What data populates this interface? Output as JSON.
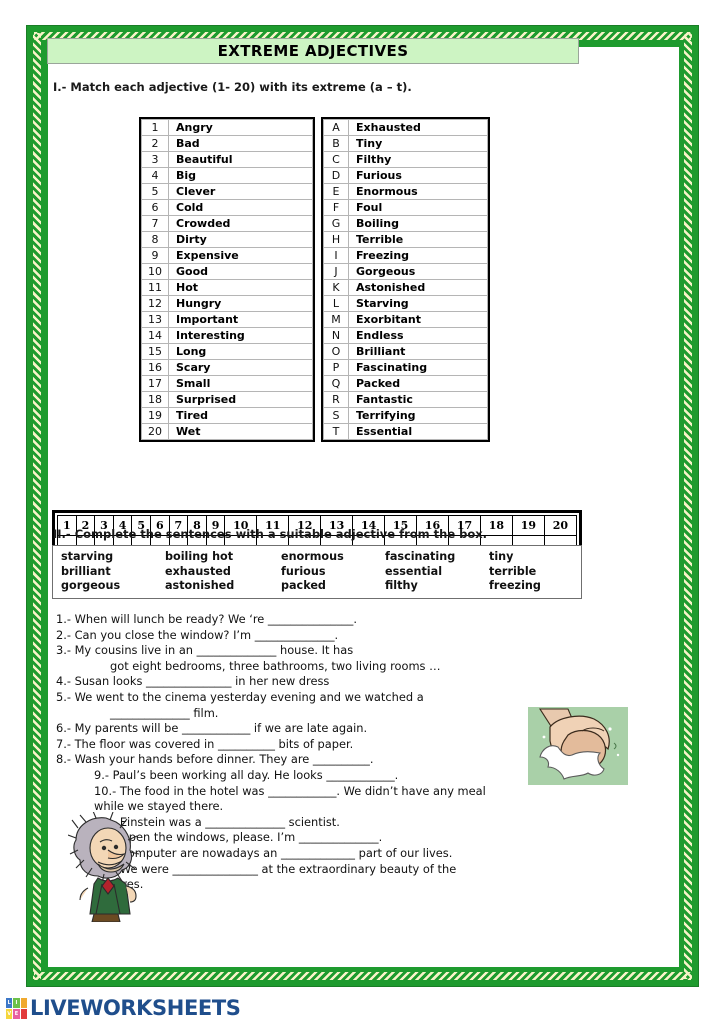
{
  "document": {
    "title": "EXTREME ADJECTIVES"
  },
  "sections": {
    "one": {
      "instruction": "I.- Match each adjective (1- 20) with its extreme (a – t).",
      "left_column": [
        {
          "key": "1",
          "word": "Angry"
        },
        {
          "key": "2",
          "word": "Bad"
        },
        {
          "key": "3",
          "word": "Beautiful"
        },
        {
          "key": "4",
          "word": "Big"
        },
        {
          "key": "5",
          "word": "Clever"
        },
        {
          "key": "6",
          "word": "Cold"
        },
        {
          "key": "7",
          "word": "Crowded"
        },
        {
          "key": "8",
          "word": "Dirty"
        },
        {
          "key": "9",
          "word": "Expensive"
        },
        {
          "key": "10",
          "word": "Good"
        },
        {
          "key": "11",
          "word": "Hot"
        },
        {
          "key": "12",
          "word": "Hungry"
        },
        {
          "key": "13",
          "word": "Important"
        },
        {
          "key": "14",
          "word": "Interesting"
        },
        {
          "key": "15",
          "word": "Long"
        },
        {
          "key": "16",
          "word": "Scary"
        },
        {
          "key": "17",
          "word": "Small"
        },
        {
          "key": "18",
          "word": "Surprised"
        },
        {
          "key": "19",
          "word": "Tired"
        },
        {
          "key": "20",
          "word": "Wet"
        }
      ],
      "right_column": [
        {
          "key": "A",
          "word": "Exhausted"
        },
        {
          "key": "B",
          "word": "Tiny"
        },
        {
          "key": "C",
          "word": "Filthy"
        },
        {
          "key": "D",
          "word": "Furious"
        },
        {
          "key": "E",
          "word": "Enormous"
        },
        {
          "key": "F",
          "word": "Foul"
        },
        {
          "key": "G",
          "word": "Boiling"
        },
        {
          "key": "H",
          "word": "Terrible"
        },
        {
          "key": "I",
          "word": "Freezing"
        },
        {
          "key": "J",
          "word": "Gorgeous"
        },
        {
          "key": "K",
          "word": "Astonished"
        },
        {
          "key": "L",
          "word": "Starving"
        },
        {
          "key": "M",
          "word": "Exorbitant"
        },
        {
          "key": "N",
          "word": "Endless"
        },
        {
          "key": "O",
          "word": "Brilliant"
        },
        {
          "key": "P",
          "word": "Fascinating"
        },
        {
          "key": "Q",
          "word": "Packed"
        },
        {
          "key": "R",
          "word": "Fantastic"
        },
        {
          "key": "S",
          "word": "Terrifying"
        },
        {
          "key": "T",
          "word": "Essential"
        }
      ],
      "answer_grid_headers": [
        "1",
        "2",
        "3",
        "4",
        "5",
        "6",
        "7",
        "8",
        "9",
        "10",
        "11",
        "12",
        "13",
        "14",
        "15",
        "16",
        "17",
        "18",
        "19",
        "20"
      ],
      "answer_grid_values": [
        "",
        "",
        "",
        "",
        "",
        "",
        "",
        "",
        "",
        "",
        "",
        "",
        "",
        "",
        "",
        "",
        "",
        "",
        "",
        ""
      ]
    },
    "two": {
      "instruction": "II.- Complete the sentences with a suitable adjective from the box.",
      "word_box": [
        [
          "starving",
          "boiling hot",
          "enormous",
          "fascinating",
          "tiny"
        ],
        [
          "brilliant",
          "exhausted",
          "furious",
          "essential",
          "terrible"
        ],
        [
          "gorgeous",
          "astonished",
          "packed",
          "filthy",
          "freezing"
        ]
      ],
      "sentences": [
        {
          "id": "s1",
          "text": "1.- When will lunch be ready? We ‘re _______________."
        },
        {
          "id": "s2",
          "text": "2.- Can you close the window? I’m ______________."
        },
        {
          "id": "s3",
          "text": "3.- My cousins live in an ______________ house. It has"
        },
        {
          "id": "s3b",
          "text": "got eight bedrooms, three bathrooms, two living rooms …",
          "indent": true
        },
        {
          "id": "s4",
          "text": "4.- Susan looks _______________ in her new dress"
        },
        {
          "id": "s5",
          "text": "5.- We went to the cinema yesterday evening and we watched a"
        },
        {
          "id": "s5b",
          "text": "______________ film.",
          "indent": true
        },
        {
          "id": "s6",
          "text": "6.- My parents will be ____________ if we are late again."
        },
        {
          "id": "s7",
          "text": "7.- The floor was covered in __________ bits of paper."
        },
        {
          "id": "s8",
          "text": "8.- Wash your hands before dinner. They are __________."
        }
      ],
      "sentences_indented": [
        {
          "id": "s9",
          "text": "9.- Paul’s been working all day. He looks ____________."
        },
        {
          "id": "s10",
          "text": "10.- The food in the hotel was ____________. We didn’t have any meal"
        },
        {
          "id": "s10b",
          "text": "while we stayed there.",
          "outdent": true
        },
        {
          "id": "s11",
          "text": "11.- Einstein was a ______________ scientist."
        },
        {
          "id": "s12",
          "text": "12.- Open the windows, please. I’m ______________."
        },
        {
          "id": "s13",
          "text": "13.- Computer are nowadays an _____________ part of our lives."
        },
        {
          "id": "s14",
          "text": "14.- We were _______________ at the extraordinary beauty of the"
        },
        {
          "id": "s14b",
          "text": "pictures.",
          "outdent": true
        }
      ]
    }
  },
  "footer": {
    "brand": "LIVEWORKSHEETS",
    "logo_letters": [
      "L",
      "I",
      "V",
      "E"
    ]
  },
  "colors": {
    "frame_green": "#1e9b2e",
    "frame_cream": "#f7f3c8",
    "title_bg": "#cdf4c3",
    "brand_blue": "#1f4e8c",
    "logo_blue": "#3d78c8",
    "logo_green": "#6cc04a",
    "logo_orange": "#f0a92e",
    "logo_yellow": "#f5d63c",
    "logo_pink": "#e85fa0",
    "logo_red": "#e23b3b"
  },
  "illustrations": {
    "hand_washing": "hand-washing-illustration",
    "einstein": "einstein-caricature-illustration"
  }
}
